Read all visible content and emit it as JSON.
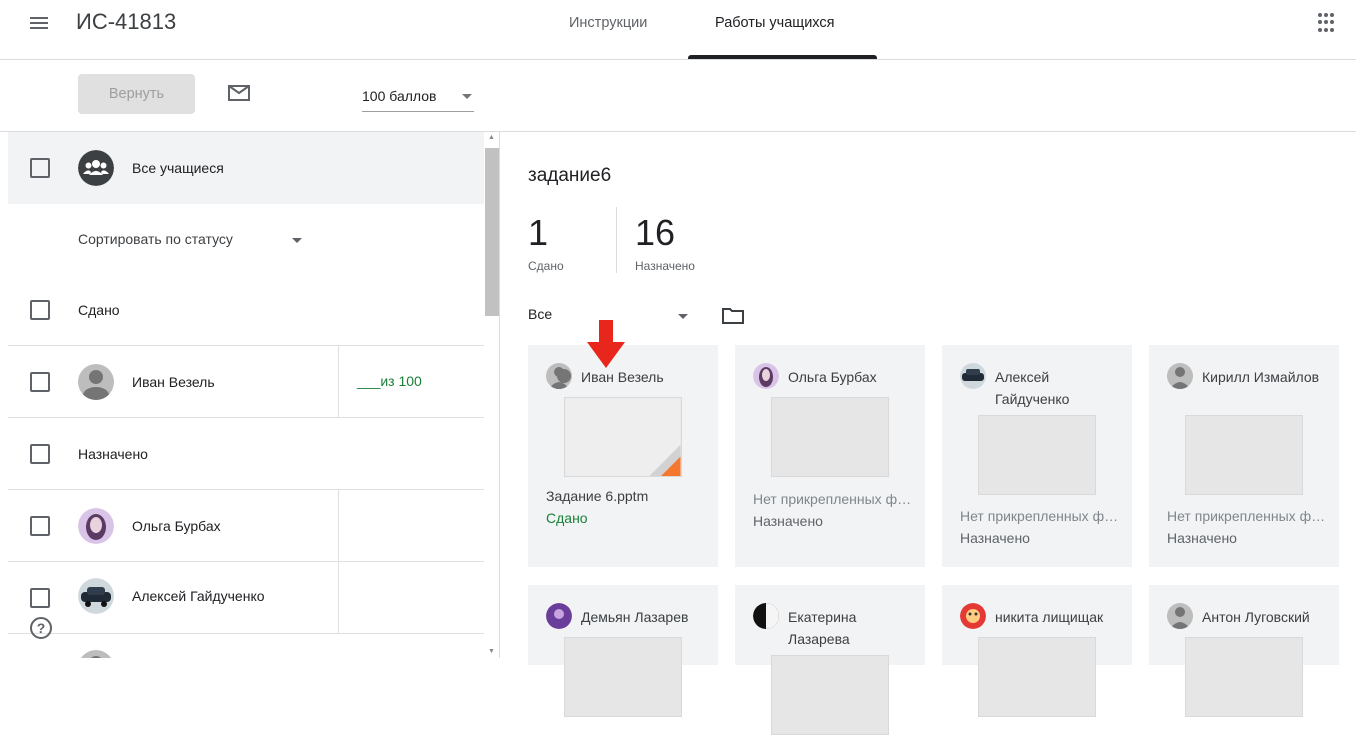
{
  "header": {
    "class_title": "ИС-41813",
    "tabs": [
      {
        "label": "Инструкции"
      },
      {
        "label": "Работы учащихся"
      }
    ]
  },
  "toolbar": {
    "return_label": "Вернуть",
    "points_value": "100 баллов"
  },
  "left_panel": {
    "all_students_label": "Все учащиеся",
    "sort_label": "Сортировать по статусу",
    "sections": [
      {
        "label": "Сдано"
      },
      {
        "label": "Назначено"
      }
    ],
    "students": [
      {
        "name": "Иван Везель",
        "grade": "___из 100"
      },
      {
        "name": "Ольга Бурбах",
        "grade": ""
      },
      {
        "name": "Алексей Гайдученко",
        "grade": ""
      }
    ]
  },
  "summary": {
    "assignment_title": "задание6",
    "turned_in_count": "1",
    "turned_in_label": "Сдано",
    "assigned_count": "16",
    "assigned_label": "Назначено",
    "filter_value": "Все"
  },
  "cards": [
    {
      "name": "Иван Везель",
      "file": "Задание 6.pptm",
      "status": "Сдано"
    },
    {
      "name": "Ольга Бурбах",
      "file": "Нет прикрепленных файлов",
      "status": "Назначено"
    },
    {
      "name": "Алексей Гайдученко",
      "file": "Нет прикрепленных файлов",
      "status": "Назначено"
    },
    {
      "name": "Кирилл Измайлов",
      "file": "Нет прикрепленных файлов",
      "status": "Назначено"
    },
    {
      "name": "Демьян Лазарев",
      "file": "",
      "status": ""
    },
    {
      "name": "Екатерина Лазарева",
      "file": "",
      "status": ""
    },
    {
      "name": "никита лищищак",
      "file": "",
      "status": ""
    },
    {
      "name": "Антон Луговский",
      "file": "",
      "status": ""
    }
  ],
  "colors": {
    "turned_in": "#188038",
    "assigned": "#5f6368",
    "arrow": "#e8261c",
    "file_accent": "#f4772e"
  },
  "icons": [
    "menu-icon",
    "apps-icon",
    "mail-icon",
    "group-icon",
    "chevron-down-icon",
    "folder-icon",
    "help-icon",
    "arrow-down-icon"
  ]
}
